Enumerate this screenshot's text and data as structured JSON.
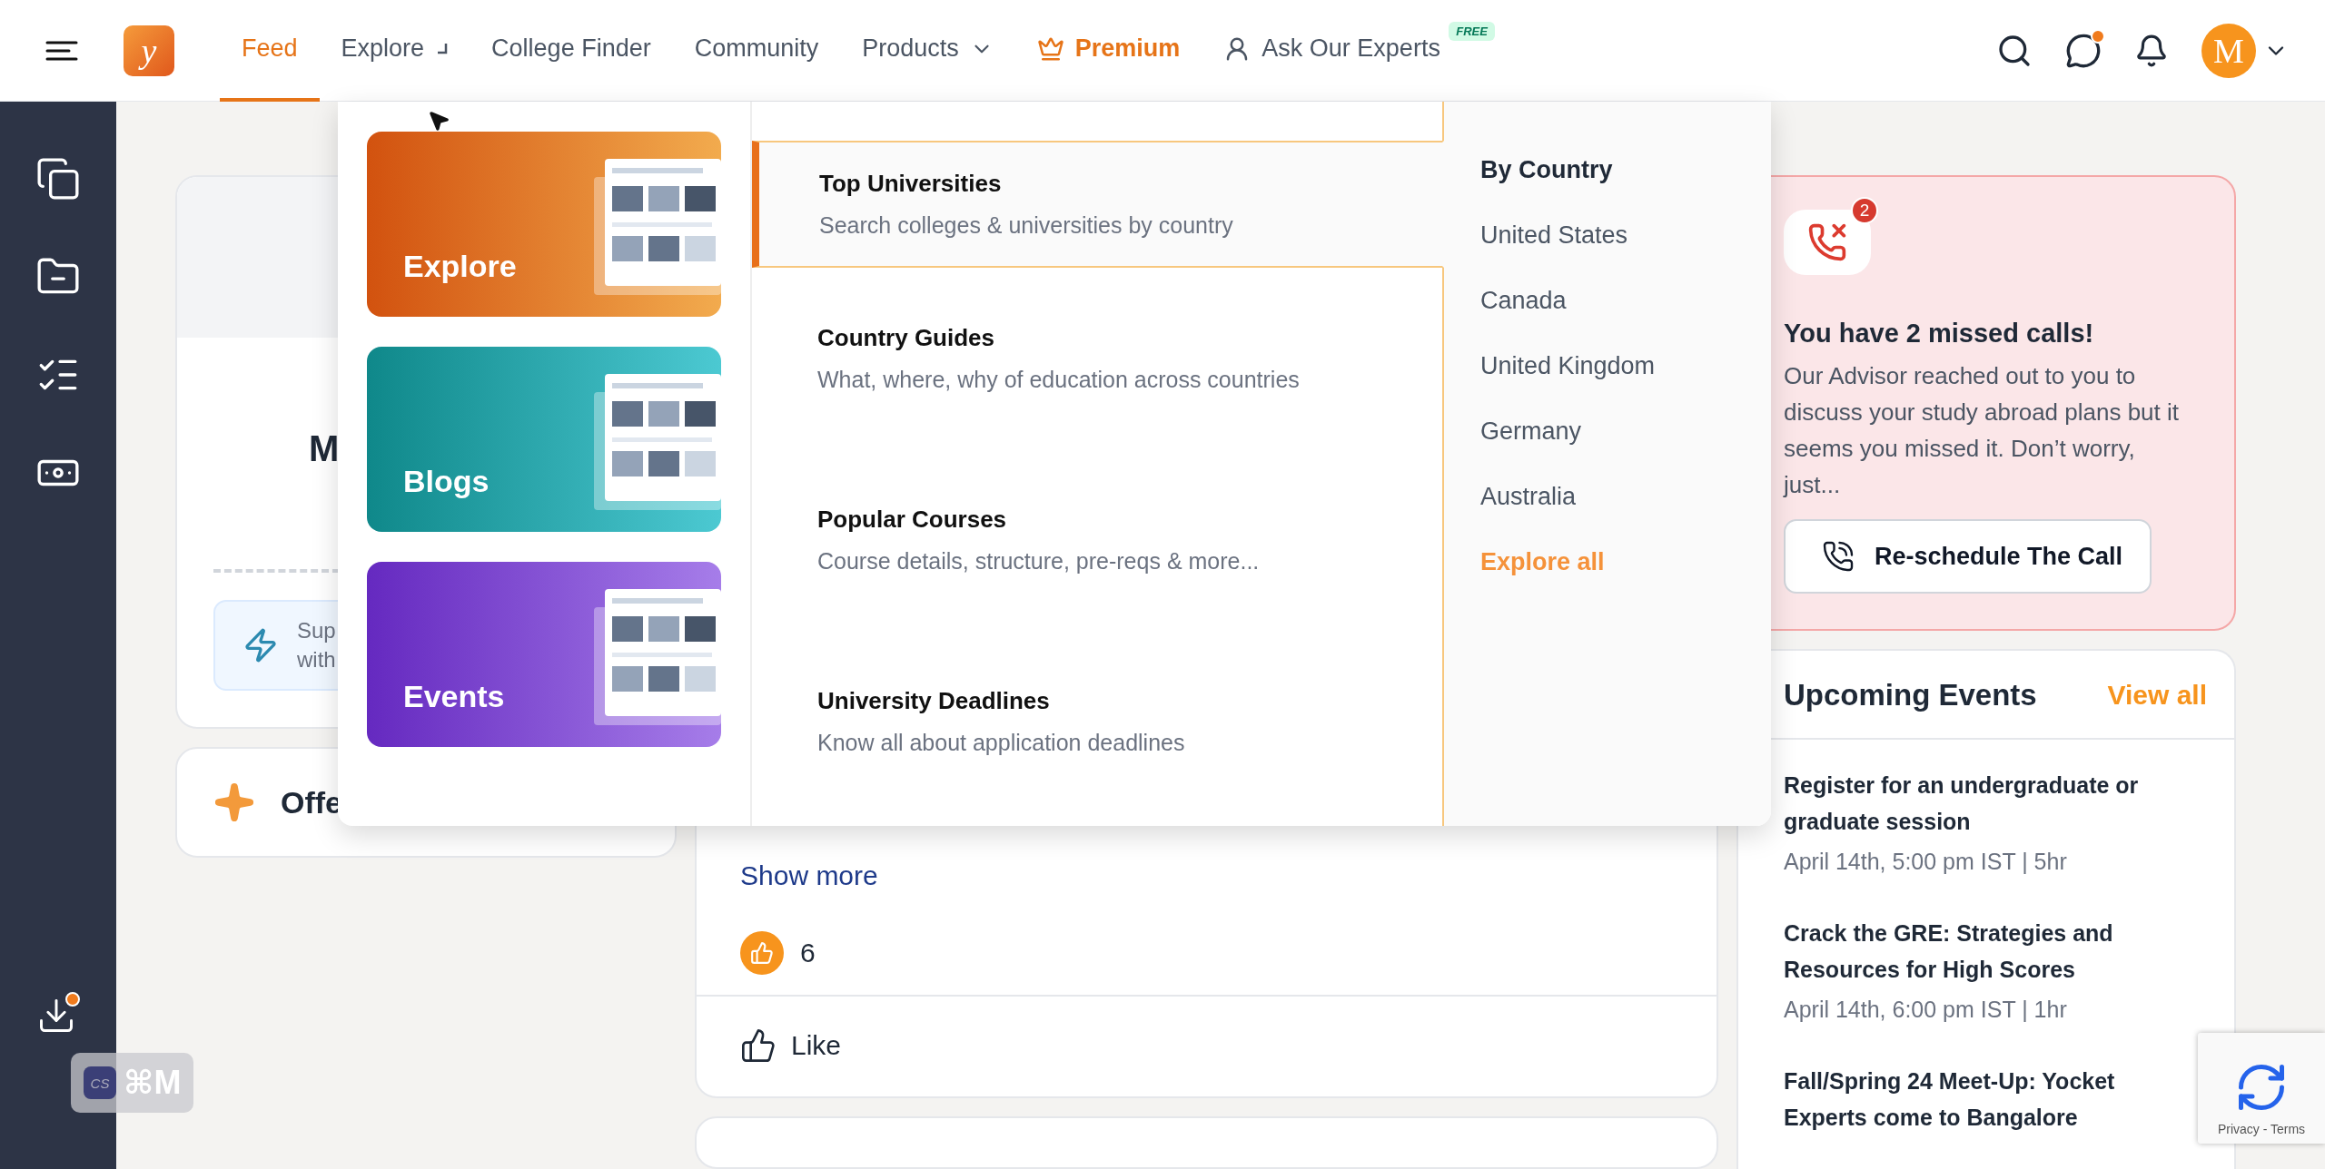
{
  "nav": {
    "logo": "y",
    "items": [
      {
        "label": "Feed",
        "selected": true,
        "kind": "link"
      },
      {
        "label": "Explore",
        "selected": false,
        "kind": "loading"
      },
      {
        "label": "College Finder",
        "selected": false,
        "kind": "link"
      },
      {
        "label": "Community",
        "selected": false,
        "kind": "link"
      },
      {
        "label": "Products",
        "selected": false,
        "kind": "menu"
      },
      {
        "label": "Premium",
        "selected": false,
        "kind": "premium"
      },
      {
        "label": "Ask Our Experts",
        "selected": false,
        "kind": "experts",
        "badge": "FREE"
      }
    ],
    "chat_unread": true,
    "avatar": "M"
  },
  "sidebar": {
    "items": [
      {
        "kind": "files"
      },
      {
        "kind": "folder"
      },
      {
        "kind": "checklist"
      },
      {
        "kind": "money"
      }
    ],
    "download": {
      "has_notification": true
    }
  },
  "shortcut": {
    "badge": "CS",
    "keys": "⌘M"
  },
  "profile_card": {
    "name": "M",
    "promo_lines": [
      "Sup",
      "with"
    ]
  },
  "offer_card": {
    "label": "Offe"
  },
  "dropdown": {
    "cards": [
      {
        "label": "Explore",
        "kind": "explore"
      },
      {
        "label": "Blogs",
        "kind": "blogs"
      },
      {
        "label": "Events",
        "kind": "events"
      }
    ],
    "items": [
      {
        "title": "Top Universities",
        "description": "Search colleges & universities by country",
        "selected": true
      },
      {
        "title": "Country Guides",
        "description": "What, where, why of education across countries",
        "selected": false
      },
      {
        "title": "Popular Courses",
        "description": "Course details, structure, pre-reqs & more...",
        "selected": false
      },
      {
        "title": "University Deadlines",
        "description": "Know all about application deadlines",
        "selected": false
      }
    ],
    "countries": {
      "heading": "By Country",
      "items": [
        "United States",
        "Canada",
        "United Kingdom",
        "Germany",
        "Australia"
      ],
      "link": "Explore all"
    }
  },
  "post": {
    "show_more": "Show more",
    "likes": "6",
    "like_button": "Like"
  },
  "missed_calls": {
    "count": "2",
    "title": "You have 2 missed calls!",
    "body": "Our Advisor reached out to you to discuss your study abroad plans but it seems you missed it. Don’t worry, just...",
    "button": "Re-schedule The Call"
  },
  "events": {
    "title": "Upcoming Events",
    "view_all": "View all",
    "items": [
      {
        "title": "Register for an undergraduate or graduate session",
        "time": "April 14th, 5:00 pm IST | 5hr"
      },
      {
        "title": "Crack the GRE: Strategies and Resources for High Scores",
        "time": "April 14th, 6:00 pm IST | 1hr"
      },
      {
        "title": "Fall/Spring 24 Meet-Up: Yocket Experts come to Bangalore"
      }
    ]
  },
  "recaptcha": {
    "links": "Privacy - Terms"
  }
}
